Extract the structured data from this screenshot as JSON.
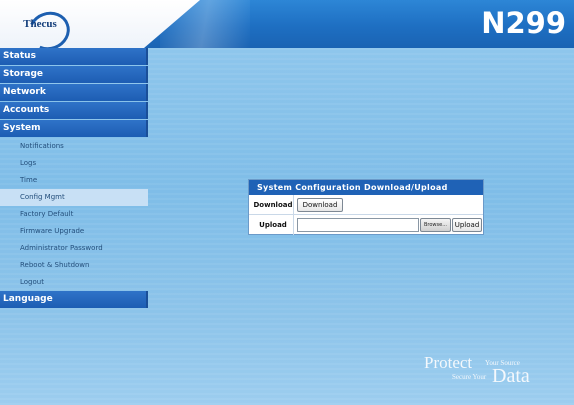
{
  "header": {
    "logo_text": "Thecus",
    "model": "N299"
  },
  "sidebar": {
    "categories": [
      {
        "label": "Status"
      },
      {
        "label": "Storage"
      },
      {
        "label": "Network"
      },
      {
        "label": "Accounts"
      },
      {
        "label": "System"
      }
    ],
    "system_items": [
      {
        "label": "Notifications"
      },
      {
        "label": "Logs"
      },
      {
        "label": "Time"
      },
      {
        "label": "Config Mgmt",
        "active": true
      },
      {
        "label": "Factory Default"
      },
      {
        "label": "Firmware Upgrade"
      },
      {
        "label": "Administrator Password"
      },
      {
        "label": "Reboot & Shutdown"
      },
      {
        "label": "Logout"
      }
    ],
    "language": {
      "label": "Language"
    }
  },
  "dialog": {
    "title": "System Configuration Download/Upload",
    "download_label": "Download",
    "download_button": "Download",
    "upload_label": "Upload",
    "upload_value": "",
    "browse_button": "Browse...",
    "upload_button": "Upload"
  },
  "brand": {
    "protect": "Protect",
    "your_source": "Your Source",
    "secure_your": "Secure Your",
    "data": "Data"
  },
  "colors": {
    "header_blue": "#1e6fc2",
    "sidebar_blue": "#1d5db3",
    "background": "#8ec6ec"
  }
}
